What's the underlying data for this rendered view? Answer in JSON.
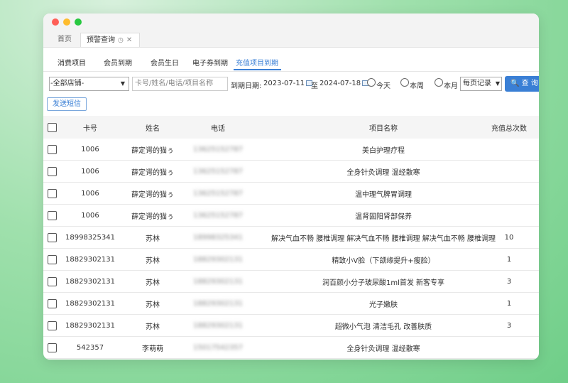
{
  "tabs": [
    {
      "label": "首页"
    },
    {
      "label": "预警查询"
    }
  ],
  "subnav": [
    "消费项目",
    "会员到期",
    "会员生日",
    "电子券到期",
    "充值项目到期"
  ],
  "filters": {
    "store": "-全部店铺-",
    "keyword_placeholder": "卡号/姓名/电话/项目名称",
    "date_label": "到期日期:",
    "date_from": "2023-07-11",
    "sep": "至",
    "date_to": "2024-07-18",
    "radio_today": "今天",
    "radio_week": "本周",
    "radio_month": "本月",
    "per_page": "每页记录",
    "query_label": "查 询"
  },
  "sms_button": "发送短信",
  "columns": [
    "卡号",
    "姓名",
    "电话",
    "项目名称",
    "充值总次数"
  ],
  "rows": [
    {
      "card": "1006",
      "name": "薛定谔的猫ぅ",
      "phone": "13625152787",
      "item": "美白护理疗程",
      "count": ""
    },
    {
      "card": "1006",
      "name": "薛定谔的猫ぅ",
      "phone": "13625152787",
      "item": "全身针灸调理 温经散寒",
      "count": ""
    },
    {
      "card": "1006",
      "name": "薛定谔的猫ぅ",
      "phone": "13625152787",
      "item": "温中理气脾胃调理",
      "count": ""
    },
    {
      "card": "1006",
      "name": "薛定谔的猫ぅ",
      "phone": "13625152787",
      "item": "温肾固阳肾部保养",
      "count": ""
    },
    {
      "card": "18998325341",
      "name": "苏林",
      "phone": "18998325341",
      "item": "解决气血不畅 腰椎调理 解决气血不畅 腰椎调理 解决气血不畅 腰椎调理",
      "count": "10"
    },
    {
      "card": "18829302131",
      "name": "苏林",
      "phone": "18829302131",
      "item": "精致小V脸（下颌缘提升+瘦脸）",
      "count": "1"
    },
    {
      "card": "18829302131",
      "name": "苏林",
      "phone": "18829302131",
      "item": "润百颜小分子玻尿酸1ml首发 新客专享",
      "count": "3"
    },
    {
      "card": "18829302131",
      "name": "苏林",
      "phone": "18829302131",
      "item": "光子嫩肤",
      "count": "1"
    },
    {
      "card": "18829302131",
      "name": "苏林",
      "phone": "18829302131",
      "item": "超微小气泡 清洁毛孔 改善肤质",
      "count": "3"
    },
    {
      "card": "542357",
      "name": "李萌萌",
      "phone": "15017542357",
      "item": "全身针灸调理 温经散寒",
      "count": ""
    }
  ]
}
